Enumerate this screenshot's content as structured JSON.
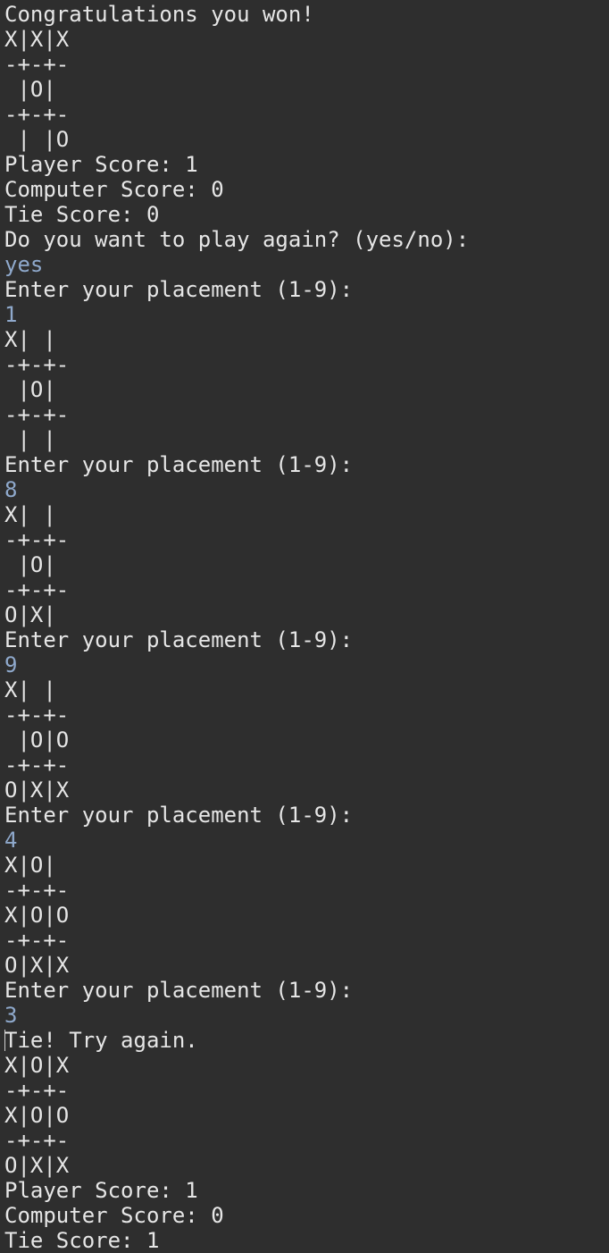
{
  "console": {
    "colors": {
      "background": "#2e2e2e",
      "output_text": "#e6e6e6",
      "user_input_text": "#8fa9cc"
    },
    "lines": [
      {
        "text": "Congratulations you won!",
        "kind": "output"
      },
      {
        "text": "X|X|X",
        "kind": "output"
      },
      {
        "text": "-+-+-",
        "kind": "output"
      },
      {
        "text": " |O|",
        "kind": "output"
      },
      {
        "text": "-+-+-",
        "kind": "output"
      },
      {
        "text": " | |O",
        "kind": "output"
      },
      {
        "text": "Player Score: 1",
        "kind": "output"
      },
      {
        "text": "Computer Score: 0",
        "kind": "output"
      },
      {
        "text": "Tie Score: 0",
        "kind": "output"
      },
      {
        "text": "Do you want to play again? (yes/no):",
        "kind": "output"
      },
      {
        "text": "yes",
        "kind": "input"
      },
      {
        "text": "Enter your placement (1-9):",
        "kind": "output"
      },
      {
        "text": "1",
        "kind": "input"
      },
      {
        "text": "X| |",
        "kind": "output"
      },
      {
        "text": "-+-+-",
        "kind": "output"
      },
      {
        "text": " |O|",
        "kind": "output"
      },
      {
        "text": "-+-+-",
        "kind": "output"
      },
      {
        "text": " | |",
        "kind": "output"
      },
      {
        "text": "Enter your placement (1-9):",
        "kind": "output"
      },
      {
        "text": "8",
        "kind": "input"
      },
      {
        "text": "X| |",
        "kind": "output"
      },
      {
        "text": "-+-+-",
        "kind": "output"
      },
      {
        "text": " |O|",
        "kind": "output"
      },
      {
        "text": "-+-+-",
        "kind": "output"
      },
      {
        "text": "O|X|",
        "kind": "output"
      },
      {
        "text": "Enter your placement (1-9):",
        "kind": "output"
      },
      {
        "text": "9",
        "kind": "input"
      },
      {
        "text": "X| |",
        "kind": "output"
      },
      {
        "text": "-+-+-",
        "kind": "output"
      },
      {
        "text": " |O|O",
        "kind": "output"
      },
      {
        "text": "-+-+-",
        "kind": "output"
      },
      {
        "text": "O|X|X",
        "kind": "output"
      },
      {
        "text": "Enter your placement (1-9):",
        "kind": "output"
      },
      {
        "text": "4",
        "kind": "input"
      },
      {
        "text": "X|O|",
        "kind": "output"
      },
      {
        "text": "-+-+-",
        "kind": "output"
      },
      {
        "text": "X|O|O",
        "kind": "output"
      },
      {
        "text": "-+-+-",
        "kind": "output"
      },
      {
        "text": "O|X|X",
        "kind": "output"
      },
      {
        "text": "Enter your placement (1-9):",
        "kind": "output"
      },
      {
        "text": "3",
        "kind": "input"
      },
      {
        "text": "Tie! Try again.",
        "kind": "output",
        "caret": true
      },
      {
        "text": "X|O|X",
        "kind": "output"
      },
      {
        "text": "-+-+-",
        "kind": "output"
      },
      {
        "text": "X|O|O",
        "kind": "output"
      },
      {
        "text": "-+-+-",
        "kind": "output"
      },
      {
        "text": "O|X|X",
        "kind": "output"
      },
      {
        "text": "Player Score: 1",
        "kind": "output"
      },
      {
        "text": "Computer Score: 0",
        "kind": "output"
      },
      {
        "text": "Tie Score: 1",
        "kind": "output"
      }
    ]
  }
}
